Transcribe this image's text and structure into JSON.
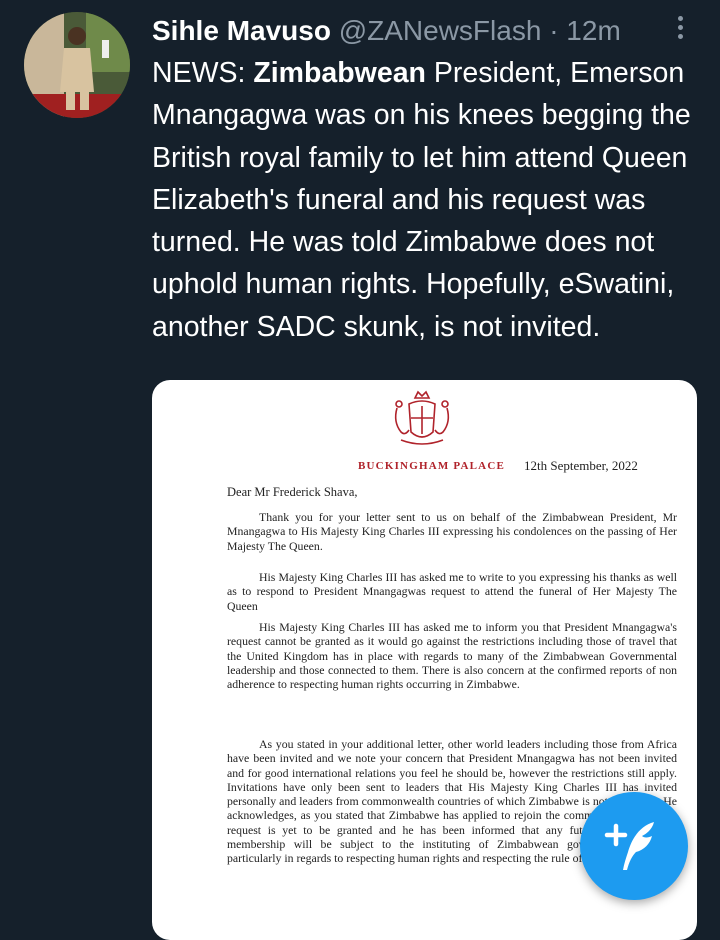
{
  "tweet": {
    "author_name": "Sihle Mavuso",
    "author_handle": "@ZANewsFlash",
    "separator": "·",
    "time_ago": "12m",
    "text_prefix": "NEWS: ",
    "text_bold": "Zimbabwean",
    "text_rest": " President, Emerson Mnangagwa was on his knees begging the British royal family to let him attend Queen Elizabeth's funeral and his request was turned. He was told Zimbabwe does not uphold human rights. Hopefully, eSwatini, another SADC skunk, is not invited."
  },
  "letter": {
    "header": "BUCKINGHAM PALACE",
    "date": "12th September, 2022",
    "salutation": "Dear  Mr Frederick Shava,",
    "paragraphs": [
      "Thank you for your letter sent to us on behalf of the Zimbabwean President,  Mr Mnangagwa to His Majesty King Charles III expressing his condolences on the passing of Her Majesty The Queen.",
      "His Majesty King Charles III has asked me to write to you expressing his thanks as well as to respond to President Mnangagwas request to attend the funeral of Her Majesty The Queen",
      "His Majesty King Charles III has asked me to inform you that President Mnangagwa's request cannot be granted as it would go against the restrictions including those of travel that the United Kingdom has in place with regards to many of the Zimbabwean Governmental leadership and those connected to them. There is also concern at the confirmed reports of non adherence to respecting human rights occurring in Zimbabwe.",
      "As you stated in your additional letter, other world leaders including those from Africa have been invited and we note your concern that President Mnangagwa has not been invited and for good international relations you feel he should be, however the restrictions still apply. Invitations have only been sent to leaders that His Majesty King Charles III has invited personally and leaders from commonwealth countries of which Zimbabwe is not a member. He acknowledges, as you stated that Zimbabwe has applied to rejoin the commonwealth but that request is yet to be granted and he has been informed that any future commonwealth membership will be subject to the instituting of Zimbabwean governmental reforms particularly in regards to respecting human rights and respecting the rule of law."
    ]
  },
  "icons": {
    "more": "more-vertical-icon",
    "compose": "compose-tweet-icon",
    "crest": "royal-crest-icon"
  },
  "colors": {
    "background": "#15202b",
    "text": "#ffffff",
    "secondary": "#8b98a5",
    "accent": "#1d9bf0",
    "palace_red": "#b0232b"
  }
}
